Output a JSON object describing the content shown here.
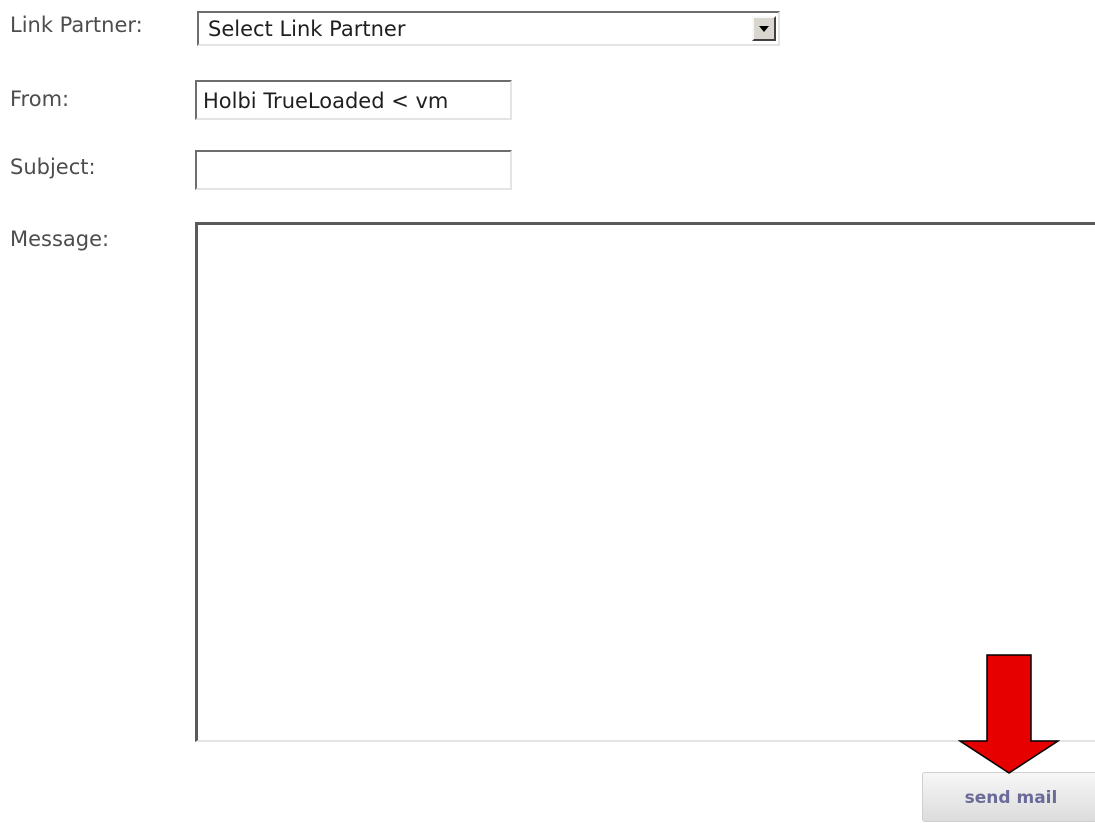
{
  "form": {
    "link_partner_label": "Link Partner:",
    "link_partner_selected": "Select Link Partner",
    "from_label": "From:",
    "from_value": "Holbi TrueLoaded < vm",
    "subject_label": "Subject:",
    "subject_value": "",
    "message_label": "Message:",
    "message_value": "",
    "send_label": "send mail"
  },
  "annotation": {
    "arrow_color": "#e60000",
    "arrow_icon": "down-arrow-icon"
  }
}
